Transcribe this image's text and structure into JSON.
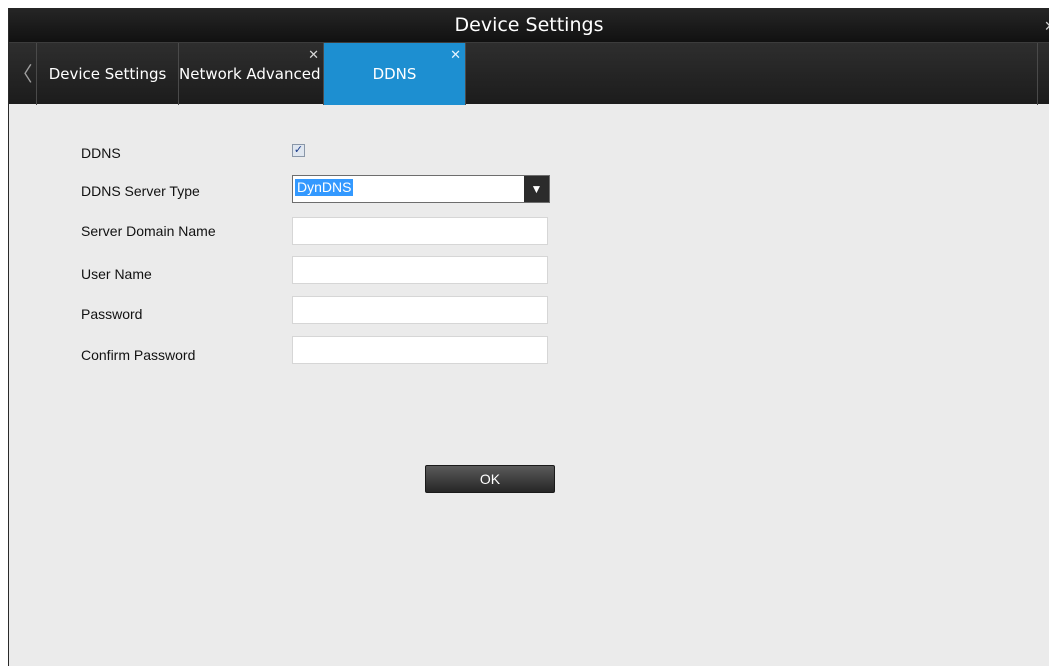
{
  "window": {
    "title": "Device Settings",
    "close_glyph": "×"
  },
  "tabs": [
    {
      "label": "Device Settings",
      "closable": false,
      "active": false
    },
    {
      "label": "Network Advanced",
      "closable": true,
      "active": false
    },
    {
      "label": "DDNS",
      "closable": true,
      "active": true
    }
  ],
  "tab_nav": {
    "prev_glyph": "〈"
  },
  "form": {
    "ddns_label": "DDNS",
    "ddns_enabled": true,
    "server_type_label": "DDNS Server Type",
    "server_type_value": "DynDNS",
    "server_domain_label": "Server Domain Name",
    "server_domain_value": "",
    "user_name_label": "User Name",
    "user_name_value": "",
    "password_label": "Password",
    "password_value": "",
    "confirm_password_label": "Confirm Password",
    "confirm_password_value": ""
  },
  "ok_label": "OK",
  "colors": {
    "active_tab": "#1d8fd1",
    "selection": "#3399ff"
  }
}
